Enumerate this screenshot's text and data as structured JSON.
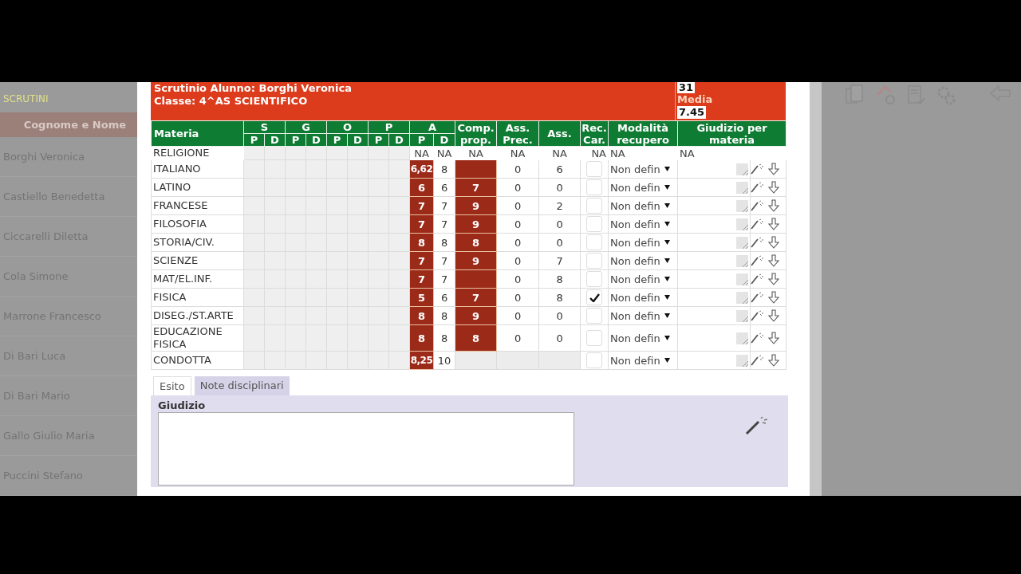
{
  "sidebar": {
    "title": "SCRUTINI",
    "header": "Cognome e Nome",
    "items": [
      "Borghi Veronica",
      "Castiello Benedetta",
      "Ciccarelli Diletta",
      "Cola Simone",
      "Marrone Francesco",
      "Di Bari Luca",
      "Di Bari Mario",
      "Gallo Giulio Maria",
      "Puccini Stefano"
    ]
  },
  "header": {
    "student": "Scrutinio Alunno: Borghi Veronica",
    "class": "Classe: 4^AS SCIENTIFICO",
    "top_value": "31",
    "media_label": "Media",
    "media_value": "7.45"
  },
  "table": {
    "columns": [
      {
        "kind": "single",
        "label": "Materia"
      },
      {
        "kind": "group",
        "label": "S",
        "sub": [
          "P",
          "D"
        ]
      },
      {
        "kind": "group",
        "label": "G",
        "sub": [
          "P",
          "D"
        ]
      },
      {
        "kind": "group",
        "label": "O",
        "sub": [
          "P",
          "D"
        ]
      },
      {
        "kind": "group",
        "label": "P",
        "sub": [
          "P",
          "D"
        ]
      },
      {
        "kind": "group",
        "label": "A",
        "sub": [
          "P",
          "D"
        ]
      },
      {
        "kind": "single",
        "label": "Comp. prop."
      },
      {
        "kind": "single",
        "label": "Ass. Prec."
      },
      {
        "kind": "single",
        "label": "Ass."
      },
      {
        "kind": "single",
        "label": "Rec. Car."
      },
      {
        "kind": "single",
        "label": "Modalità recupero"
      },
      {
        "kind": "wide",
        "label": "Giudizio per materia"
      }
    ],
    "rows": [
      {
        "kind": "na",
        "subject": "RELIGIONE",
        "a_p": "NA",
        "a_d": "NA",
        "comp": "NA",
        "ass_prec": "NA",
        "ass": "NA",
        "rec": "NA",
        "modalita": "NA",
        "giudizio": "NA"
      },
      {
        "kind": "graded",
        "subject": "ITALIANO",
        "a_p": "6,62",
        "a_d": "8",
        "ass_prec": "0",
        "ass": "6",
        "rec_checked": false,
        "modalita": "Non defin"
      },
      {
        "kind": "graded",
        "subject": "LATINO",
        "a_p": "6",
        "a_d": "6",
        "comp": "7",
        "ass_prec": "0",
        "ass": "0",
        "rec_checked": false,
        "modalita": "Non defin"
      },
      {
        "kind": "graded",
        "subject": "FRANCESE",
        "a_p": "7",
        "a_d": "7",
        "comp": "9",
        "ass_prec": "0",
        "ass": "2",
        "rec_checked": false,
        "modalita": "Non defin"
      },
      {
        "kind": "graded",
        "subject": "FILOSOFIA",
        "a_p": "7",
        "a_d": "7",
        "comp": "9",
        "ass_prec": "0",
        "ass": "0",
        "rec_checked": false,
        "modalita": "Non defin"
      },
      {
        "kind": "graded",
        "subject": "STORIA/CIV.",
        "a_p": "8",
        "a_d": "8",
        "comp": "8",
        "ass_prec": "0",
        "ass": "0",
        "rec_checked": false,
        "modalita": "Non defin"
      },
      {
        "kind": "graded",
        "subject": "SCIENZE",
        "a_p": "7",
        "a_d": "7",
        "comp": "9",
        "ass_prec": "0",
        "ass": "7",
        "rec_checked": false,
        "modalita": "Non defin"
      },
      {
        "kind": "graded",
        "subject": "MAT/EL.INF.",
        "a_p": "7",
        "a_d": "7",
        "ass_prec": "0",
        "ass": "8",
        "rec_checked": false,
        "modalita": "Non defin"
      },
      {
        "kind": "graded",
        "subject": "FISICA",
        "a_p": "5",
        "a_d": "6",
        "comp": "7",
        "ass_prec": "0",
        "ass": "8",
        "rec_checked": true,
        "modalita": "Non defin"
      },
      {
        "kind": "graded",
        "subject": "DISEG./ST.ARTE",
        "a_p": "8",
        "a_d": "8",
        "comp": "9",
        "ass_prec": "0",
        "ass": "0",
        "rec_checked": false,
        "modalita": "Non defin"
      },
      {
        "kind": "graded",
        "subject": "EDUCAZIONE FISICA",
        "a_p": "8",
        "a_d": "8",
        "comp": "8",
        "ass_prec": "0",
        "ass": "0",
        "rec_checked": false,
        "modalita": "Non defin"
      },
      {
        "kind": "conduct",
        "subject": "CONDOTTA",
        "a_p": "8,25",
        "a_d": "10",
        "rec_checked": false,
        "modalita": "Non defin"
      }
    ]
  },
  "tabs": [
    {
      "label": "Esito",
      "selected": true
    },
    {
      "label": "Note disciplinari",
      "selected": false
    }
  ],
  "panel": {
    "label": "Giudizio"
  }
}
